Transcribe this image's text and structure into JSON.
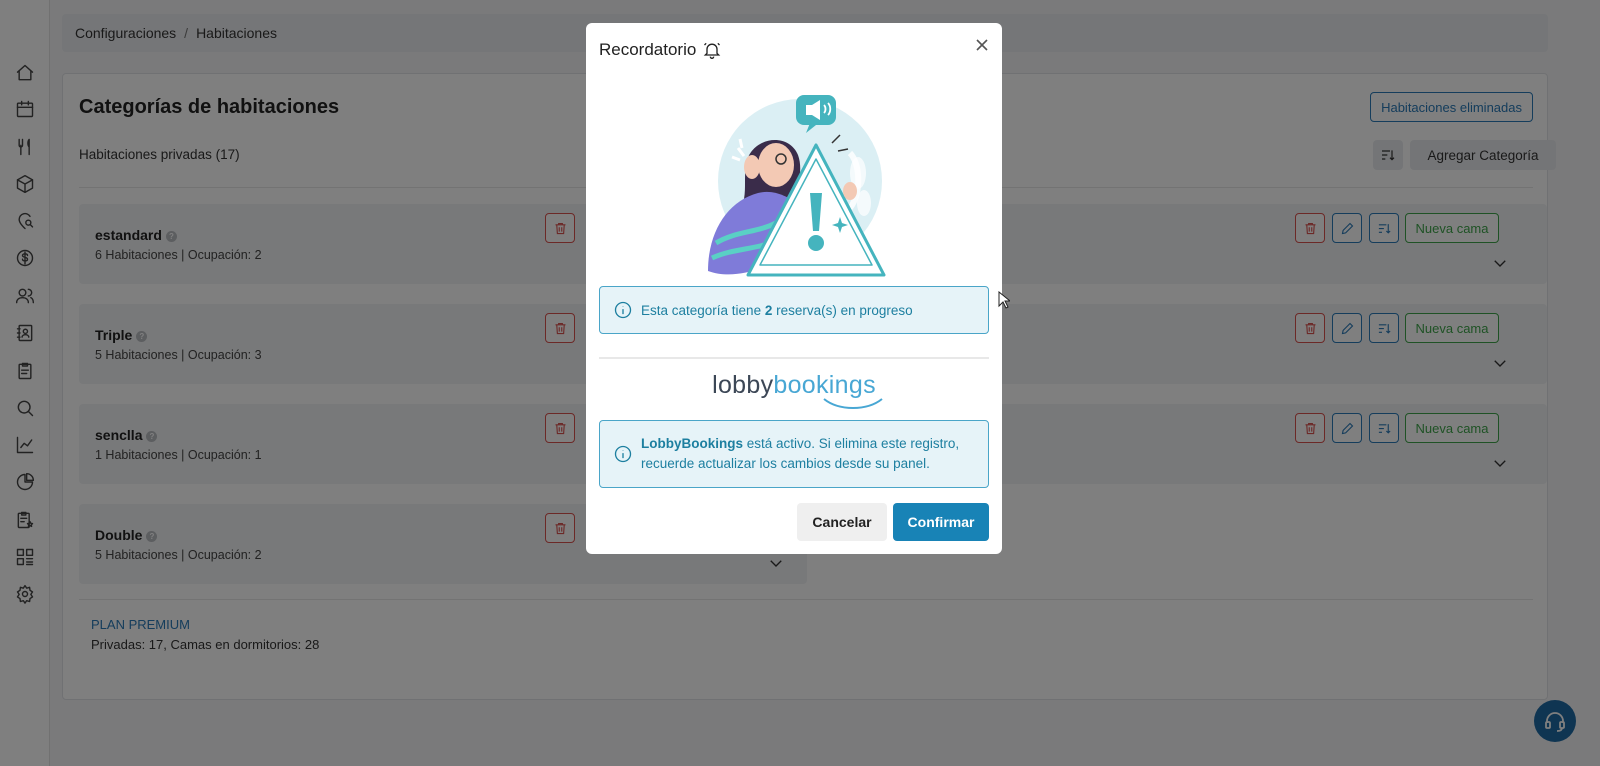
{
  "breadcrumb": {
    "items": [
      "Configuraciones",
      "Habitaciones"
    ],
    "separator": "/"
  },
  "page": {
    "title": "Categorías de habitaciones",
    "deleted_rooms_button": "Habitaciones eliminadas",
    "subtitle": "Habitaciones privadas (17)",
    "add_category_button": "Agregar Categoría"
  },
  "categories": [
    {
      "name": "estandard",
      "info": "6 Habitaciones | Ocupación: 2",
      "new_bed_label": "Nueva cama"
    },
    {
      "name": "Triple",
      "info": "5 Habitaciones | Ocupación: 3",
      "new_bed_label": "Nueva cama"
    },
    {
      "name": "senclla",
      "info": "1 Habitaciones | Ocupación: 1",
      "new_bed_label": "Nueva cama"
    },
    {
      "name": "Double",
      "info": "5 Habitaciones | Ocupación: 2"
    }
  ],
  "plan": {
    "name": "PLAN PREMIUM",
    "info": "Privadas: 17, Camas en dormitorios: 28"
  },
  "sidebar": {
    "icons": [
      "home-icon",
      "calendar-icon",
      "utensils-icon",
      "box-icon",
      "location-search-icon",
      "dollar-icon",
      "users-icon",
      "address-book-icon",
      "clipboard-icon",
      "search-icon",
      "chart-line-icon",
      "chart-pie-icon",
      "clipboard-star-icon",
      "grid-icon",
      "settings-icon"
    ]
  },
  "modal": {
    "title": "Recordatorio",
    "alert1": {
      "prefix": "Esta categoría tiene ",
      "count": "2",
      "suffix": " reserva(s) en progreso"
    },
    "logo": {
      "part1": "lobby",
      "part2": "bookings"
    },
    "alert2": {
      "brand": "LobbyBookings",
      "line1_rest": " está activo. Si elimina este registro,",
      "line2": "recuerde actualizar los cambios desde su panel."
    },
    "cancel_label": "Cancelar",
    "confirm_label": "Confirmar"
  },
  "colors": {
    "accent_blue": "#2a7ab8",
    "danger": "#d9534f",
    "success": "#3fa54b",
    "confirm": "#1883b6",
    "info_bg": "#e6f3f8",
    "info_text": "#1d7fa0",
    "logo_dark": "#3c4756",
    "logo_light": "#48a7d4"
  }
}
